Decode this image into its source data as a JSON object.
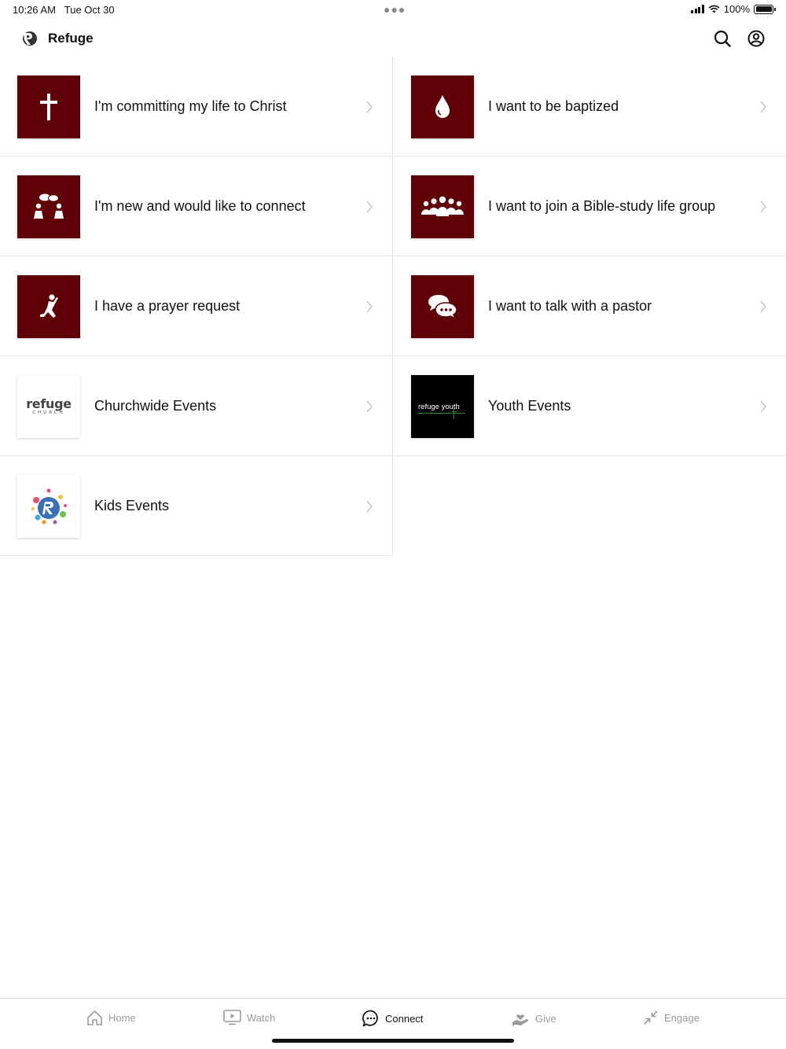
{
  "status_bar": {
    "time": "10:26 AM",
    "date": "Tue Oct 30",
    "battery": "100%"
  },
  "header": {
    "title": "Refuge"
  },
  "items": [
    {
      "label": "I'm committing my life to Christ",
      "icon": "cross-icon"
    },
    {
      "label": "I want to be baptized",
      "icon": "water-drop-icon"
    },
    {
      "label": "I'm new and would like to connect",
      "icon": "people-chat-icon"
    },
    {
      "label": "I want to join a Bible-study life group",
      "icon": "group-icon"
    },
    {
      "label": "I have a prayer request",
      "icon": "kneeling-prayer-icon"
    },
    {
      "label": "I want to talk with a pastor",
      "icon": "speech-bubbles-icon"
    },
    {
      "label": "Churchwide Events",
      "thumb_text": "refuge",
      "thumb_sub": "CHURCH"
    },
    {
      "label": "Youth Events",
      "thumb_text": "refuge youth"
    },
    {
      "label": "Kids Events",
      "icon": "kids-logo-icon"
    }
  ],
  "tabs": [
    {
      "label": "Home",
      "icon": "home-icon"
    },
    {
      "label": "Watch",
      "icon": "tv-play-icon"
    },
    {
      "label": "Connect",
      "icon": "chat-bubble-icon",
      "active": true
    },
    {
      "label": "Give",
      "icon": "hand-heart-icon"
    },
    {
      "label": "Engage",
      "icon": "arrows-collapse-icon"
    }
  ],
  "colors": {
    "tile": "#5e0006",
    "accent_active": "#111111",
    "inactive": "#9a9a9a"
  }
}
